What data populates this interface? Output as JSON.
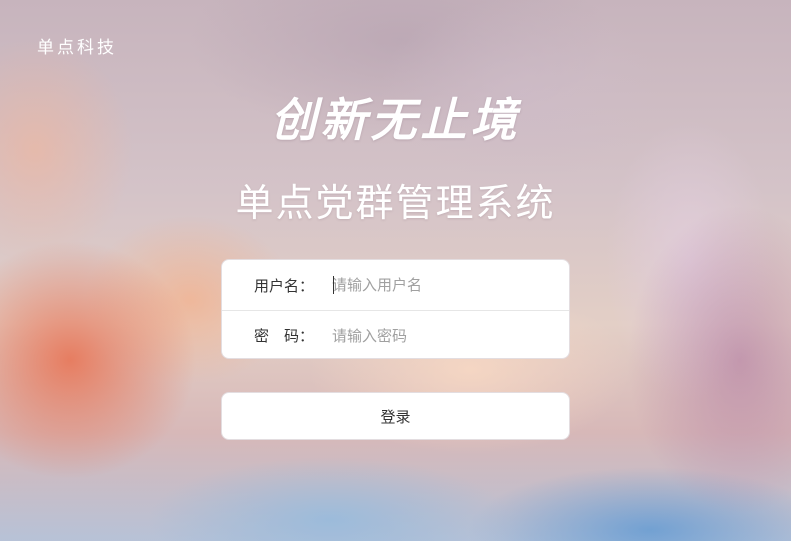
{
  "brand": {
    "name": "单点科技"
  },
  "hero": {
    "slogan": "创新无止境",
    "system_title": "单点党群管理系统"
  },
  "login_form": {
    "username": {
      "label": "用户名：",
      "placeholder": "请输入用户名",
      "value": ""
    },
    "password": {
      "label": "密　码：",
      "placeholder": "请输入密码",
      "value": ""
    },
    "submit_label": "登录"
  }
}
